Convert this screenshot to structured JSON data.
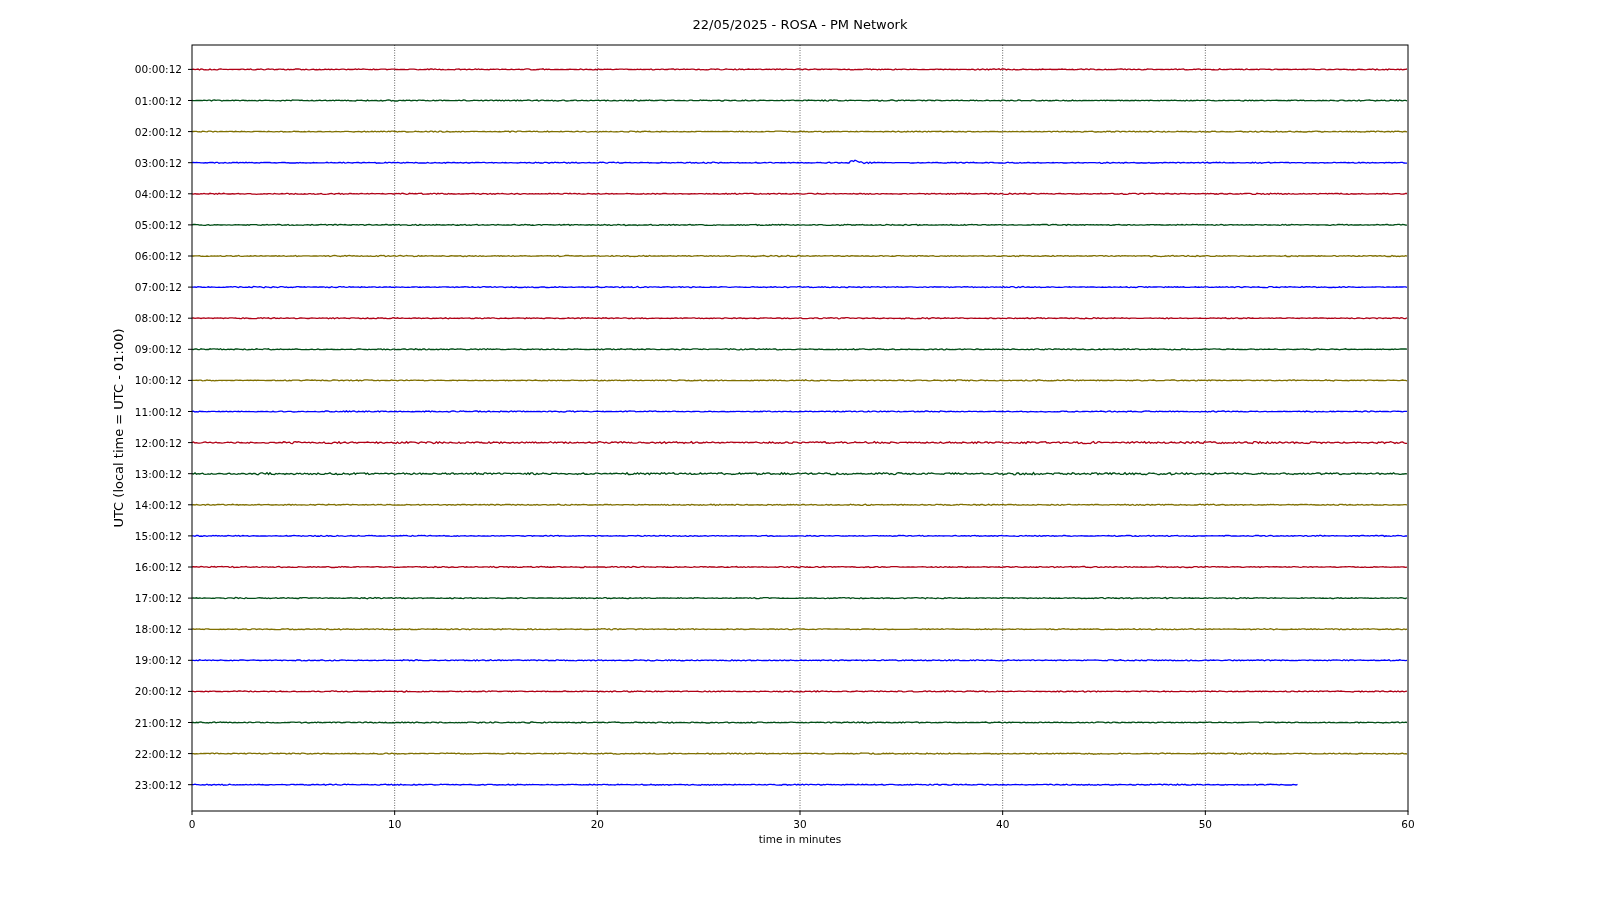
{
  "title": "22/05/2025 - ROSA - PM Network",
  "xlabel": "time in minutes",
  "ylabel": "UTC (local time = UTC - 01:00)",
  "xticks": [
    "0",
    "10",
    "20",
    "30",
    "40",
    "50",
    "60"
  ],
  "rows": [
    {
      "label": "00:00:12",
      "color": "#b00016",
      "level": 1
    },
    {
      "label": "01:00:12",
      "color": "#004d16",
      "level": 1
    },
    {
      "label": "02:00:12",
      "color": "#7f6f00",
      "level": 1
    },
    {
      "label": "03:00:12",
      "color": "#0000ff",
      "level": 1
    },
    {
      "label": "04:00:12",
      "color": "#b00016",
      "level": 1
    },
    {
      "label": "05:00:12",
      "color": "#004d16",
      "level": 1
    },
    {
      "label": "06:00:12",
      "color": "#7f6f00",
      "level": 1
    },
    {
      "label": "07:00:12",
      "color": "#0000ff",
      "level": 1
    },
    {
      "label": "08:00:12",
      "color": "#b00016",
      "level": 1
    },
    {
      "label": "09:00:12",
      "color": "#004d16",
      "level": 1
    },
    {
      "label": "10:00:12",
      "color": "#7f6f00",
      "level": 1
    },
    {
      "label": "11:00:12",
      "color": "#0000ff",
      "level": 1
    },
    {
      "label": "12:00:12",
      "color": "#b00016",
      "level": 1
    },
    {
      "label": "13:00:12",
      "color": "#004d16",
      "level": 1
    },
    {
      "label": "14:00:12",
      "color": "#7f6f00",
      "level": 1
    },
    {
      "label": "15:00:12",
      "color": "#0000ff",
      "level": 1
    },
    {
      "label": "16:00:12",
      "color": "#b00016",
      "level": 1
    },
    {
      "label": "17:00:12",
      "color": "#004d16",
      "level": 1
    },
    {
      "label": "18:00:12",
      "color": "#7f6f00",
      "level": 1
    },
    {
      "label": "19:00:12",
      "color": "#0000ff",
      "level": 1
    },
    {
      "label": "20:00:12",
      "color": "#b00016",
      "level": 1
    },
    {
      "label": "21:00:12",
      "color": "#004d16",
      "level": 1
    },
    {
      "label": "22:00:12",
      "color": "#7f6f00",
      "level": 1
    },
    {
      "label": "23:00:12",
      "color": "#0000ff",
      "level": 0.91
    }
  ]
}
